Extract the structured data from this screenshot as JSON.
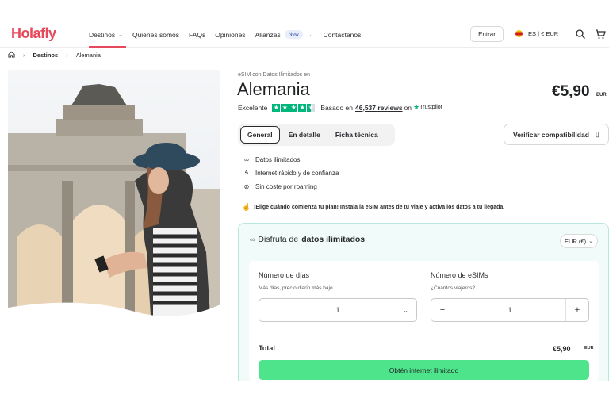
{
  "header": {
    "logo": "Holafly",
    "nav": [
      {
        "label": "Destinos",
        "has_dropdown": true,
        "active": true
      },
      {
        "label": "Quiénes somos"
      },
      {
        "label": "FAQs"
      },
      {
        "label": "Opiniones"
      },
      {
        "label": "Alianzas",
        "badge": "New",
        "has_dropdown": true
      },
      {
        "label": "Contáctanos"
      }
    ],
    "login_label": "Entrar",
    "lang_currency": "ES | € EUR",
    "icons": [
      "search-icon",
      "cart-icon"
    ]
  },
  "breadcrumb": {
    "items": [
      "Destinos",
      "Alemania"
    ],
    "home_icon": "home-icon"
  },
  "product": {
    "subtitle": "eSIM con Datos Ilimitados en",
    "title": "Alemania",
    "price": "€5,90",
    "price_currency": "EUR",
    "rating": {
      "label": "Excelente",
      "stars": 4.5,
      "based_on": "Basado en",
      "reviews": "46,537 reviews",
      "on": "on",
      "provider": "Trustpilot"
    }
  },
  "tabs": [
    {
      "label": "General",
      "active": true
    },
    {
      "label": "En detalle"
    },
    {
      "label": "Ficha técnica"
    }
  ],
  "verify_button": "Verificar compatibilidad",
  "features": [
    {
      "icon": "infinity-icon",
      "label": "Datos ilimitados"
    },
    {
      "icon": "lightning-icon",
      "label": "Internet rápido y de confianza"
    },
    {
      "icon": "no-roaming-icon",
      "label": "Sin coste por roaming"
    }
  ],
  "notice": "¡Elige cuándo comienza tu plan! Instala la eSIM antes de tu viaje y activa los datos a tu llegada.",
  "plan": {
    "heading_prefix": "Disfruta de",
    "heading_bold": "datos ilimitados",
    "currency_select": "EUR (€)",
    "days": {
      "label": "Número de días",
      "help": "Más días, precio diario más bajo",
      "value": "1"
    },
    "esims": {
      "label": "Número de eSIMs",
      "help": "¿Cuántos viajeros?",
      "value": "1"
    },
    "total_label": "Total",
    "total_value": "€5,90",
    "total_currency": "EUR",
    "cta": "Obtén internet ilimitado"
  },
  "colors": {
    "brand": "#e6485c",
    "cta": "#4ee48b",
    "trustpilot": "#00b67a",
    "plan_bg": "#f0fbfa"
  }
}
